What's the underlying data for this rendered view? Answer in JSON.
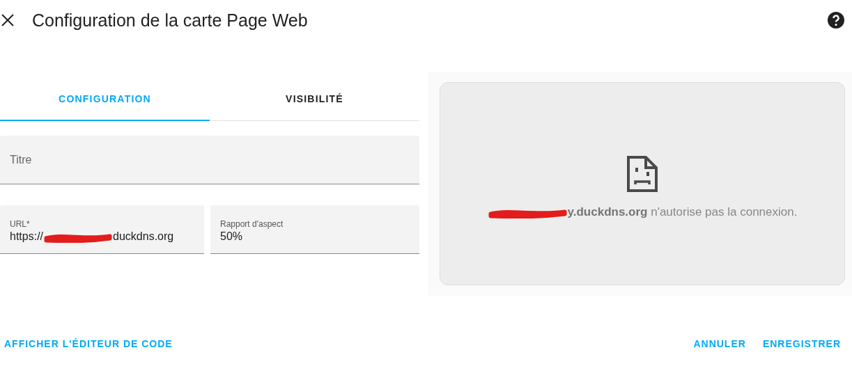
{
  "dialog": {
    "title": "Configuration de la carte Page Web"
  },
  "tabs": [
    {
      "label": "CONFIGURATION",
      "selected": true
    },
    {
      "label": "VISIBILITÉ",
      "selected": false
    }
  ],
  "fields": {
    "title": {
      "placeholder": "Titre"
    },
    "url": {
      "label": "URL*",
      "value_start": "https://",
      "value_end": "duckdns.org"
    },
    "aspect_ratio": {
      "label": "Rapport d'aspect",
      "value": "50%"
    }
  },
  "preview": {
    "error_message": "**y.duckdns.org** n'autorise pas la connexion."
  },
  "footer": {
    "code_editor": "AFFICHER L'ÉDITEUR DE CODE",
    "cancel": "ANNULER",
    "save": "ENREGISTRER"
  }
}
